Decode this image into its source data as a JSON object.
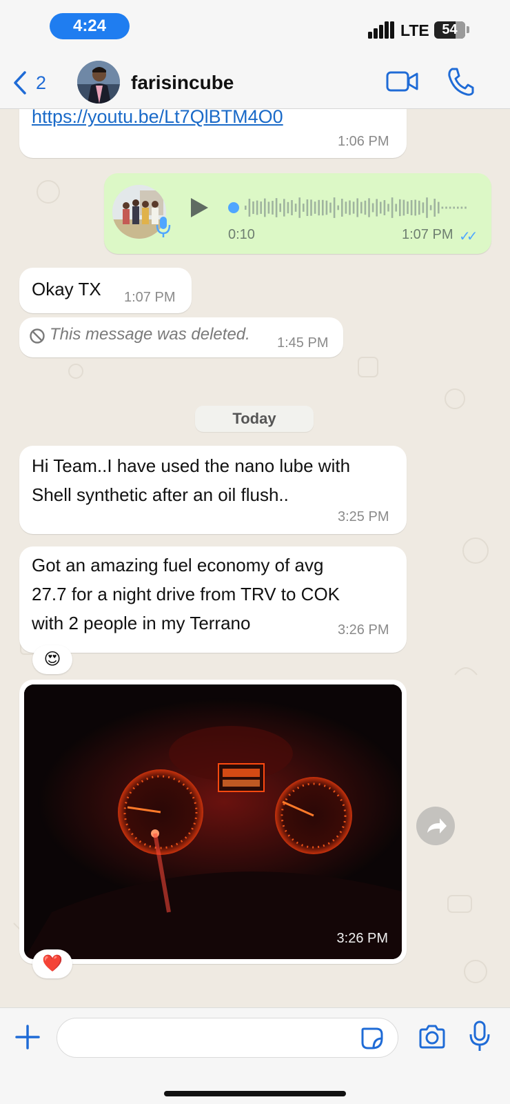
{
  "status_bar": {
    "time": "4:24",
    "network": "LTE",
    "battery": "54"
  },
  "header": {
    "back_count": "2",
    "contact_name": "farisincube"
  },
  "messages": {
    "link": {
      "url": "https://youtu.be/Lt7QlBTM4O0",
      "time": "1:06 PM"
    },
    "voice": {
      "duration": "0:10",
      "time": "1:07 PM"
    },
    "okay": {
      "text": "Okay TX",
      "time": "1:07 PM"
    },
    "deleted": {
      "text": "This message was deleted.",
      "time": "1:45 PM"
    },
    "date_divider": "Today",
    "msg1": {
      "line1": "Hi Team..I have used the nano lube with",
      "line2": "Shell synthetic after an oil flush..",
      "time": "3:25 PM"
    },
    "msg2": {
      "line1": "Got an amazing fuel economy of avg",
      "line2": "27.7 for a night drive from TRV to COK",
      "line3": "with 2 people in my Terrano",
      "time": "3:26 PM",
      "reaction": "😍"
    },
    "photo": {
      "time": "3:26 PM",
      "reaction": "❤️"
    }
  },
  "composer": {
    "placeholder": ""
  },
  "colors": {
    "accent": "#1f6bd6",
    "outgoing_bubble": "#dcf8c6",
    "chat_bg": "#efeae2",
    "read_ticks": "#4fa6ff"
  }
}
